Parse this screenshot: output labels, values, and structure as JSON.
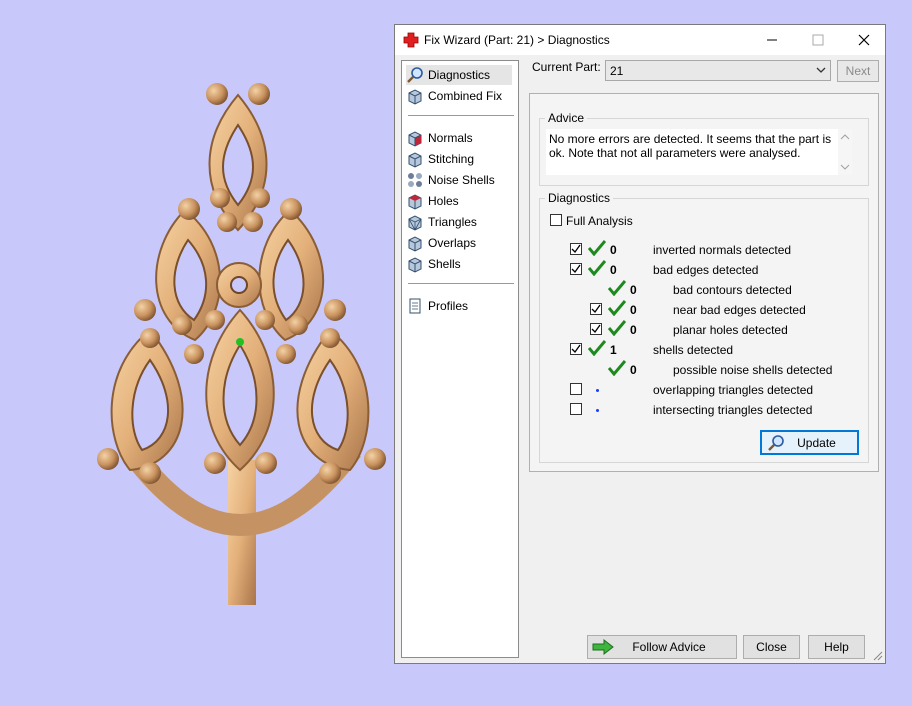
{
  "window": {
    "title": "Fix Wizard (Part: 21) > Diagnostics",
    "icon": "red-cross-icon"
  },
  "nav": {
    "items": [
      {
        "label": "Diagnostics",
        "icon": "magnifier-icon"
      },
      {
        "label": "Combined Fix",
        "icon": "cube-icon"
      },
      {
        "label": "Normals",
        "icon": "normals-cube-icon"
      },
      {
        "label": "Stitching",
        "icon": "stitching-cube-icon"
      },
      {
        "label": "Noise Shells",
        "icon": "noise-shells-icon"
      },
      {
        "label": "Holes",
        "icon": "holes-cube-icon"
      },
      {
        "label": "Triangles",
        "icon": "triangles-cube-icon"
      },
      {
        "label": "Overlaps",
        "icon": "overlaps-cube-icon"
      },
      {
        "label": "Shells",
        "icon": "shells-cube-icon"
      },
      {
        "label": "Profiles",
        "icon": "profiles-doc-icon"
      }
    ]
  },
  "header": {
    "current_part_label": "Current Part:",
    "current_part_value": "21",
    "next_label": "Next"
  },
  "advice": {
    "title": "Advice",
    "text": "No more errors are detected. It seems that the part is ok. Note that not all parameters were analysed."
  },
  "diagnostics": {
    "title": "Diagnostics",
    "full_analysis_label": "Full Analysis",
    "rows": [
      {
        "count": "0",
        "label": "inverted normals detected"
      },
      {
        "count": "0",
        "label": "bad edges detected"
      },
      {
        "count": "0",
        "label": "bad contours detected"
      },
      {
        "count": "0",
        "label": "near bad edges detected"
      },
      {
        "count": "0",
        "label": "planar holes detected"
      },
      {
        "count": "1",
        "label": "shells detected"
      },
      {
        "count": "0",
        "label": "possible noise shells detected"
      },
      {
        "count": "",
        "label": "overlapping triangles detected"
      },
      {
        "count": "",
        "label": "intersecting triangles detected"
      }
    ],
    "update_label": "Update"
  },
  "footer": {
    "follow_advice_label": "Follow Advice",
    "close_label": "Close",
    "help_label": "Help"
  },
  "colors": {
    "viewport_bg": "#c8c8fa",
    "model": "#e8b57c",
    "check_green": "#1e8a1e",
    "accent_blue": "#1a3cff"
  }
}
